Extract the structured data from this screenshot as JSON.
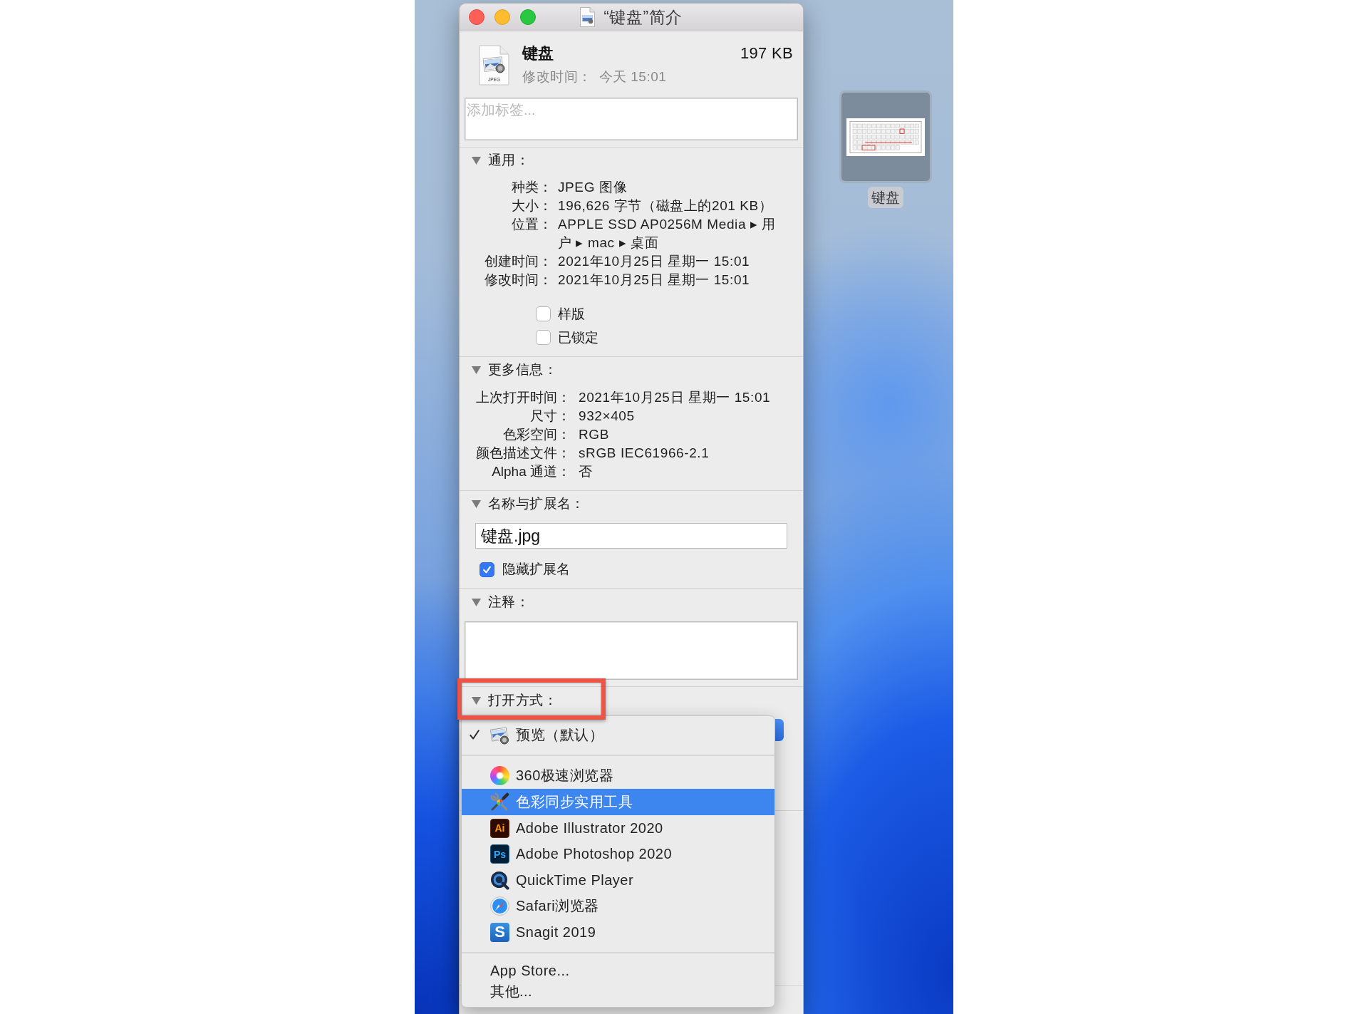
{
  "window": {
    "title": "“键盘”简介"
  },
  "header": {
    "file_icon_label": "JPEG",
    "name": "键盘",
    "size": "197 KB",
    "modified_label": "修改时间：",
    "modified_value": "今天 15:01"
  },
  "tags_field": {
    "placeholder": "添加标签..."
  },
  "general": {
    "title": "通用：",
    "expanded": true,
    "rows": [
      {
        "label": "种类：",
        "value": "JPEG 图像"
      },
      {
        "label": "大小：",
        "value": "196,626 字节（磁盘上的201 KB）"
      },
      {
        "label": "位置：",
        "value": "APPLE SSD AP0256M Media ▸ 用户 ▸ mac ▸ 桌面"
      },
      {
        "label": "创建时间：",
        "value": "2021年10月25日 星期一 15:01"
      },
      {
        "label": "修改时间：",
        "value": "2021年10月25日 星期一 15:01"
      }
    ],
    "checkboxes": [
      {
        "label": "样版",
        "checked": false
      },
      {
        "label": "已锁定",
        "checked": false
      }
    ]
  },
  "more_info": {
    "title": "更多信息：",
    "expanded": true,
    "rows": [
      {
        "label": "上次打开时间：",
        "value": "2021年10月25日 星期一 15:01"
      },
      {
        "label": "尺寸：",
        "value": "932×405"
      },
      {
        "label": "色彩空间：",
        "value": "RGB"
      },
      {
        "label": "颜色描述文件：",
        "value": "sRGB IEC61966-2.1"
      },
      {
        "label": "Alpha 通道：",
        "value": "否"
      }
    ]
  },
  "name_extension": {
    "title": "名称与扩展名：",
    "expanded": true,
    "name_field": {
      "value": "键盘.jpg"
    },
    "hide_extension": {
      "label": "隐藏扩展名",
      "checked": true
    }
  },
  "comments": {
    "title": "注释：",
    "expanded": true
  },
  "open_with": {
    "title": "打开方式：",
    "expanded": true,
    "highlighted": true,
    "menu": {
      "groups": [
        {
          "items": [
            {
              "kind": "app",
              "label": "预览（默认）",
              "checked": true,
              "selected": false
            }
          ]
        },
        {
          "items": [
            {
              "kind": "app",
              "label": "360极速浏览器",
              "checked": false,
              "selected": false
            },
            {
              "kind": "app",
              "label": "色彩同步实用工具",
              "checked": false,
              "selected": true
            },
            {
              "kind": "app",
              "label": "Adobe Illustrator 2020",
              "logo_text": "Ai",
              "checked": false,
              "selected": false
            },
            {
              "kind": "app",
              "label": "Adobe Photoshop 2020",
              "logo_text": "Ps",
              "checked": false,
              "selected": false
            },
            {
              "kind": "app",
              "label": "QuickTime Player",
              "checked": false,
              "selected": false
            },
            {
              "kind": "app",
              "label": "Safari浏览器",
              "checked": false,
              "selected": false
            },
            {
              "kind": "app",
              "label": "Snagit 2019",
              "logo_text": "S",
              "checked": false,
              "selected": false
            }
          ]
        },
        {
          "items": [
            {
              "kind": "command",
              "label": "App Store...",
              "checked": false,
              "selected": false
            },
            {
              "kind": "command",
              "label": "其他...",
              "checked": false,
              "selected": false
            }
          ]
        }
      ]
    }
  },
  "desktop_icon": {
    "label": "键盘",
    "selected": true
  }
}
